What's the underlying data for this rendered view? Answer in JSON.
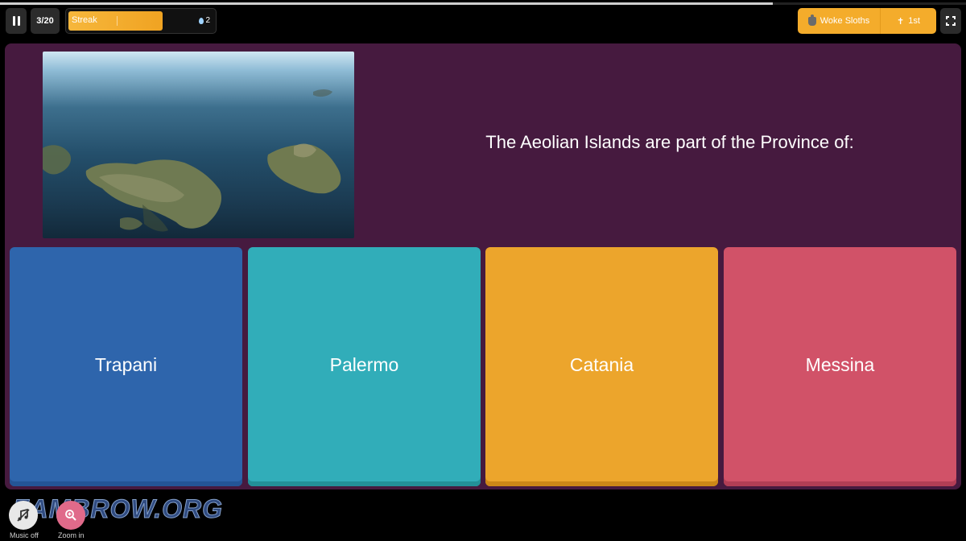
{
  "top_progress": {
    "fraction": 0.8
  },
  "question_count": "3/20",
  "streak": {
    "label": "Streak",
    "value": "2",
    "fill_fraction": 0.65
  },
  "team": {
    "name": "Woke Sloths",
    "rank": "1st"
  },
  "question": {
    "text": "The Aeolian Islands are part of the Province of:"
  },
  "answers": [
    {
      "label": "Trapani",
      "color": "#2e65ac",
      "shade": "#245596"
    },
    {
      "label": "Palermo",
      "color": "#31adb9",
      "shade": "#239098"
    },
    {
      "label": "Catania",
      "color": "#eca52c",
      "shade": "#cc8718"
    },
    {
      "label": "Messina",
      "color": "#d15268",
      "shade": "#b23e55"
    }
  ],
  "controls": {
    "music_label": "Music off",
    "zoom_label": "Zoom in"
  },
  "watermark": "ZAMBROW.ORG",
  "icons": [
    "pause-icon",
    "trophy-icon",
    "medal-icon",
    "fullscreen-icon",
    "music-icon",
    "zoom-icon",
    "drop-icon"
  ]
}
